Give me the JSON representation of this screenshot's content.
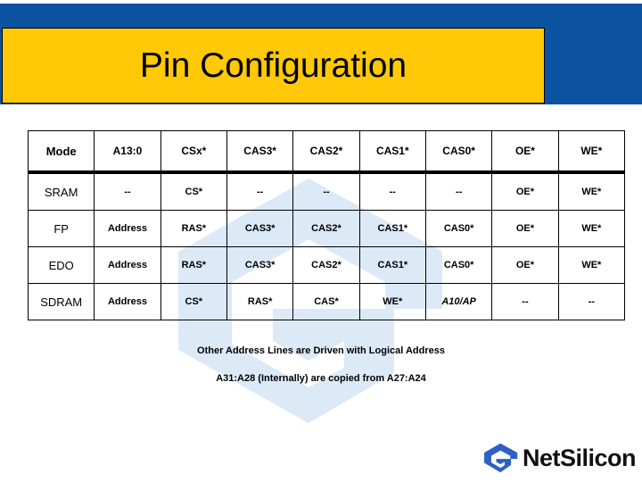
{
  "slide": {
    "title": "Pin Configuration",
    "brand_blue": "#0B52A0",
    "brand_gold": "#FFC907",
    "watermark_blue": "#DCE9F7"
  },
  "table": {
    "columns": [
      "Mode",
      "A13:0",
      "CSx*",
      "CAS3*",
      "CAS2*",
      "CAS1*",
      "CAS0*",
      "OE*",
      "WE*"
    ],
    "rows": [
      {
        "mode": "SRAM",
        "cells": [
          "--",
          "CS*",
          "--",
          "--",
          "--",
          "--",
          "OE*",
          "WE*"
        ],
        "italic": [
          false,
          false,
          false,
          false,
          false,
          false,
          false,
          false
        ]
      },
      {
        "mode": "FP",
        "cells": [
          "Address",
          "RAS*",
          "CAS3*",
          "CAS2*",
          "CAS1*",
          "CAS0*",
          "OE*",
          "WE*"
        ],
        "italic": [
          false,
          false,
          false,
          false,
          false,
          false,
          false,
          false
        ]
      },
      {
        "mode": "EDO",
        "cells": [
          "Address",
          "RAS*",
          "CAS3*",
          "CAS2*",
          "CAS1*",
          "CAS0*",
          "OE*",
          "WE*"
        ],
        "italic": [
          false,
          false,
          false,
          false,
          false,
          false,
          false,
          false
        ]
      },
      {
        "mode": "SDRAM",
        "cells": [
          "Address",
          "CS*",
          "RAS*",
          "CAS*",
          "WE*",
          "A10/AP",
          "--",
          "--"
        ],
        "italic": [
          false,
          false,
          false,
          false,
          false,
          true,
          false,
          false
        ]
      }
    ]
  },
  "footnotes": [
    "Other Address Lines are Driven with Logical Address",
    "A31:A28 (Internally) are copied from A27:A24"
  ],
  "logo": {
    "text": "NetSilicon",
    "mark_color": "#2F5FC4",
    "icon_name": "netsilicon-logo-mark"
  }
}
